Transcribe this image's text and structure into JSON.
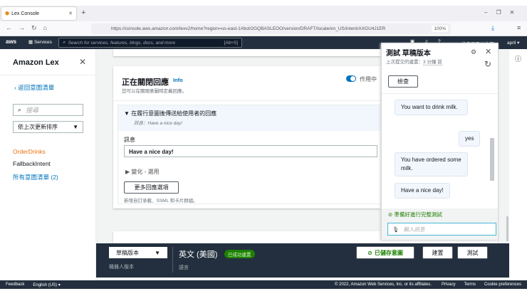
{
  "browser": {
    "tab_title": "Lex Console",
    "url": "https://console.aws.amazon.com/lexv2/home?region=us-east-1#bot/2GQBASLEOO/version/DRAFT/locale/en_US/intent/AXGU4J1ER",
    "zoom": "100%"
  },
  "aws_nav": {
    "services": "Services",
    "search_placeholder": "Search for services, features, blogs, docs, and more",
    "shortcut": "[Alt+S]",
    "region": "維吉尼亞州北部 ▾",
    "user": "april ▾"
  },
  "sidebar": {
    "title": "Amazon Lex",
    "back": "返回意圖清單",
    "search_placeholder": "搜尋",
    "sort": "依上次更新排序",
    "intents": [
      "OrderDrinks",
      "FallbackIntent"
    ],
    "all_intents": "所有意圖清單 (2)"
  },
  "closing": {
    "title": "正在關閉回應",
    "info": "Info",
    "desc": "您可以在關閉意圖時定義回應。",
    "toggle_label": "作用中",
    "toggle_on": true,
    "section_title": "在履行意圖後傳送給使用者的回應",
    "section_sub": "訊息：Have a nice day!",
    "message_label": "訊息",
    "message_value": "Have a nice day!",
    "variations": "變化 - 選用",
    "more_button": "更多回應選項",
    "more_hint": "新增自訂承載、SSML 和卡片群組。"
  },
  "test_panel": {
    "title": "測試 草稿版本",
    "last_build": "上次提交的建置：",
    "time": "3 分鐘 前",
    "inspect": "檢查",
    "messages": [
      {
        "from": "bot",
        "text": "You want to drink milk."
      },
      {
        "from": "user",
        "text": "yes"
      },
      {
        "from": "bot",
        "text": "You have ordered some milk."
      },
      {
        "from": "bot",
        "text": "Have a nice day!"
      }
    ],
    "status": "準備好進行完整測試",
    "input_placeholder": "輸入訊息"
  },
  "bottom_bar": {
    "version": "草稿版本",
    "version_label": "機器人版本",
    "language": "英文 (美國)",
    "language_label": "語言",
    "badge": "已成功建置",
    "saved": "已儲存意圖",
    "build": "建置",
    "test": "測試"
  },
  "footer": {
    "feedback": "Feedback",
    "language": "English (US) ▾",
    "copyright": "© 2022, Amazon Web Services, Inc. or its affiliates.",
    "privacy": "Privacy",
    "terms": "Terms",
    "cookies": "Cookie preferences"
  }
}
